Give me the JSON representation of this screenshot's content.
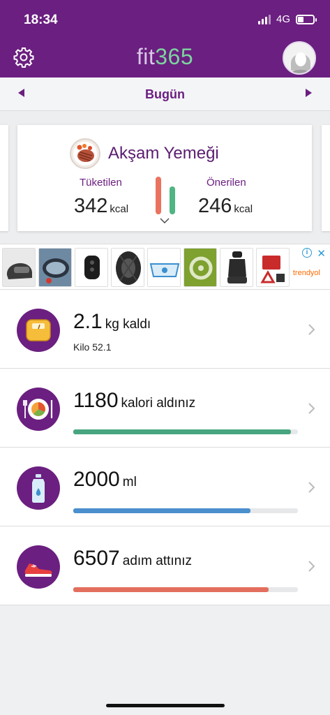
{
  "status_bar": {
    "time": "18:34",
    "network": "4G"
  },
  "header": {
    "logo_part1": "fit",
    "logo_part2": "365",
    "settings_icon": "gear-icon",
    "avatar_icon": "user-avatar-icon",
    "colors": {
      "brand": "#6b1f80",
      "logo_light": "#d8c7e6",
      "logo_green": "#7cd49e"
    }
  },
  "date_nav": {
    "label": "Bugün"
  },
  "meal_card": {
    "title": "Akşam Yemeği",
    "icon": "steak-plate-icon",
    "consumed_label": "Tüketilen",
    "consumed_value": "342",
    "consumed_unit": "kcal",
    "recommended_label": "Önerilen",
    "recommended_value": "246",
    "recommended_unit": "kcal"
  },
  "ad": {
    "brand": "trendyol",
    "info_symbol": "i",
    "close_symbol": "✕",
    "items": [
      "helmet",
      "car-mirror-film",
      "car-key",
      "tire",
      "windshield-cover",
      "steering-cover",
      "seat-cover",
      "emergency-kit"
    ]
  },
  "rows": [
    {
      "icon": "scale-icon",
      "value": "2.1",
      "unit": "kg kaldı",
      "sub": "Kilo 52.1"
    },
    {
      "icon": "plate-icon",
      "value": "1180",
      "unit": "kalori aldınız",
      "progress": 0.97,
      "color": "#47a57f"
    },
    {
      "icon": "water-bottle-icon",
      "value": "2000",
      "unit": "ml",
      "progress": 0.79,
      "color": "#4a8fce"
    },
    {
      "icon": "sneaker-icon",
      "value": "6507",
      "unit": "adım attınız",
      "progress": 0.87,
      "color": "#e36e5e"
    }
  ]
}
